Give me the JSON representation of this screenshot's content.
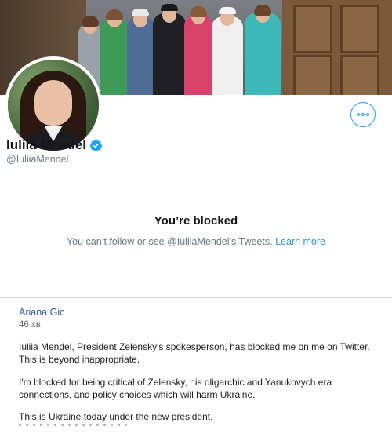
{
  "twitter": {
    "display_name": "Iuliia Mendel",
    "handle": "@IuliiaMendel",
    "blocked_title": "You’re blocked",
    "blocked_text": "You can’t follow or see @IuliiaMendel’s Tweets.",
    "learn_more": "Learn more",
    "colors": {
      "accent": "#1da1f2",
      "verified": "#1da1f2",
      "name": "#14171a",
      "muted": "#657786"
    },
    "icons": [
      "more-icon",
      "verified-badge-icon"
    ]
  },
  "facebook": {
    "author": "Ariana Gic",
    "time": "46 хв.",
    "paragraphs": [
      "Iuliia Mendel, President Zelensky's spokesperson, has blocked me on me on Twitter. This is beyond inappropriate.",
      "I'm blocked for being critical of Zelensky, his oligarchic and Yanukovych era connections, and policy choices which will harm Ukraine.",
      "This is Ukraine today under the new president."
    ],
    "colors": {
      "author": "#385898",
      "text": "#1c1e21",
      "muted": "#606770"
    }
  }
}
